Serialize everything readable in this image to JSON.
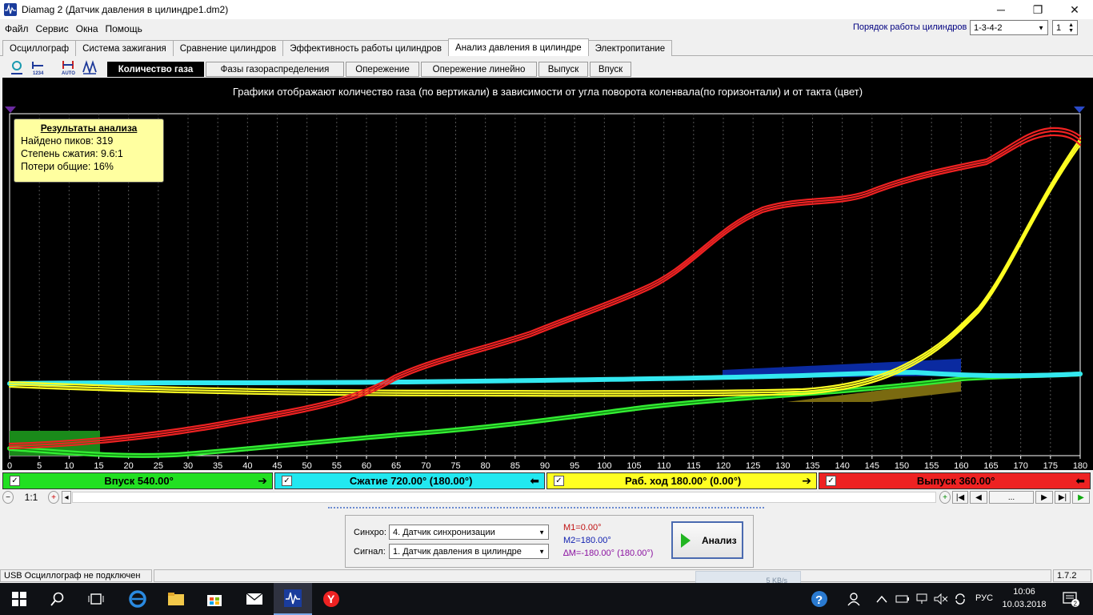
{
  "window": {
    "title": "Diamag 2 (Датчик давления в цилиндре1.dm2)",
    "minimize": "─",
    "maximize": "❐",
    "close": "✕"
  },
  "menu": [
    "Файл",
    "Сервис",
    "Окна",
    "Помощь"
  ],
  "cylinder_order": {
    "label": "Порядок работы цилиндров",
    "value": "1-3-4-2",
    "spin_value": "1"
  },
  "main_tabs": [
    "Осциллограф",
    "Система зажигания",
    "Сравнение цилиндров",
    "Эффективность работы цилиндров",
    "Анализ давления в цилиндре",
    "Электропитание"
  ],
  "main_tab_active": "Анализ давления в цилиндре",
  "sub_tabs": [
    "Количество газа",
    "Фазы газораспределения",
    "Опережение",
    "Опережение линейно",
    "Выпуск",
    "Впуск"
  ],
  "tool_icons": [
    "graph-tool-icon",
    "numbering-icon",
    "auto-scale-icon",
    "overlay-icon"
  ],
  "plot": {
    "caption": "Графики отображают количество газа (по вертикали) в зависимости от угла поворота коленвала(по горизонтали) и от такта (цвет)",
    "x_ticks": [
      "0",
      "5",
      "10",
      "15",
      "20",
      "25",
      "30",
      "35",
      "40",
      "45",
      "50",
      "55",
      "60",
      "65",
      "70",
      "75",
      "80",
      "85",
      "90",
      "95",
      "100",
      "105",
      "110",
      "115",
      "120",
      "125",
      "130",
      "135",
      "140",
      "145",
      "150",
      "155",
      "160",
      "165",
      "170",
      "175",
      "180"
    ],
    "colors": {
      "intake": "#33ee33",
      "compression": "#33e8f0",
      "power": "#ffff22",
      "exhaust": "#ee2222"
    }
  },
  "results": {
    "title": "Результаты анализа",
    "peaks": "Найдено пиков: 319",
    "compression": "Степень сжатия: 9.6:1",
    "losses": "Потери общие: 16%"
  },
  "phases": [
    {
      "label": "Впуск 540.00°",
      "arrow": "➔",
      "color": "#22e022"
    },
    {
      "label": "Сжатие 720.00° (180.00°)",
      "arrow": "⬅",
      "color": "#22e8f0"
    },
    {
      "label": "Раб. ход 180.00° (0.00°)",
      "arrow": "➔",
      "color": "#ffff22"
    },
    {
      "label": "Выпуск 360.00°",
      "arrow": "⬅",
      "color": "#ee2222"
    }
  ],
  "zoom": {
    "ratio": "1:1",
    "dots": "..."
  },
  "analysis": {
    "sync_label": "Синхро:",
    "sync_value": "4.  Датчик синхронизации",
    "signal_label": "Сигнал:",
    "signal_value": "1.  Датчик давления в цилиндре",
    "m1": "M1=0.00°",
    "m2": "M2=180.00°",
    "dm": "∆M=-180.00° (180.00°)",
    "button": "Анализ"
  },
  "status": {
    "usb": "USB Осциллограф не подключен",
    "version": "1.7.2",
    "net": "5 KB/s"
  },
  "taskbar": {
    "lang": "РУС",
    "time": "10:06",
    "date": "10.03.2018",
    "notifications": "2"
  }
}
